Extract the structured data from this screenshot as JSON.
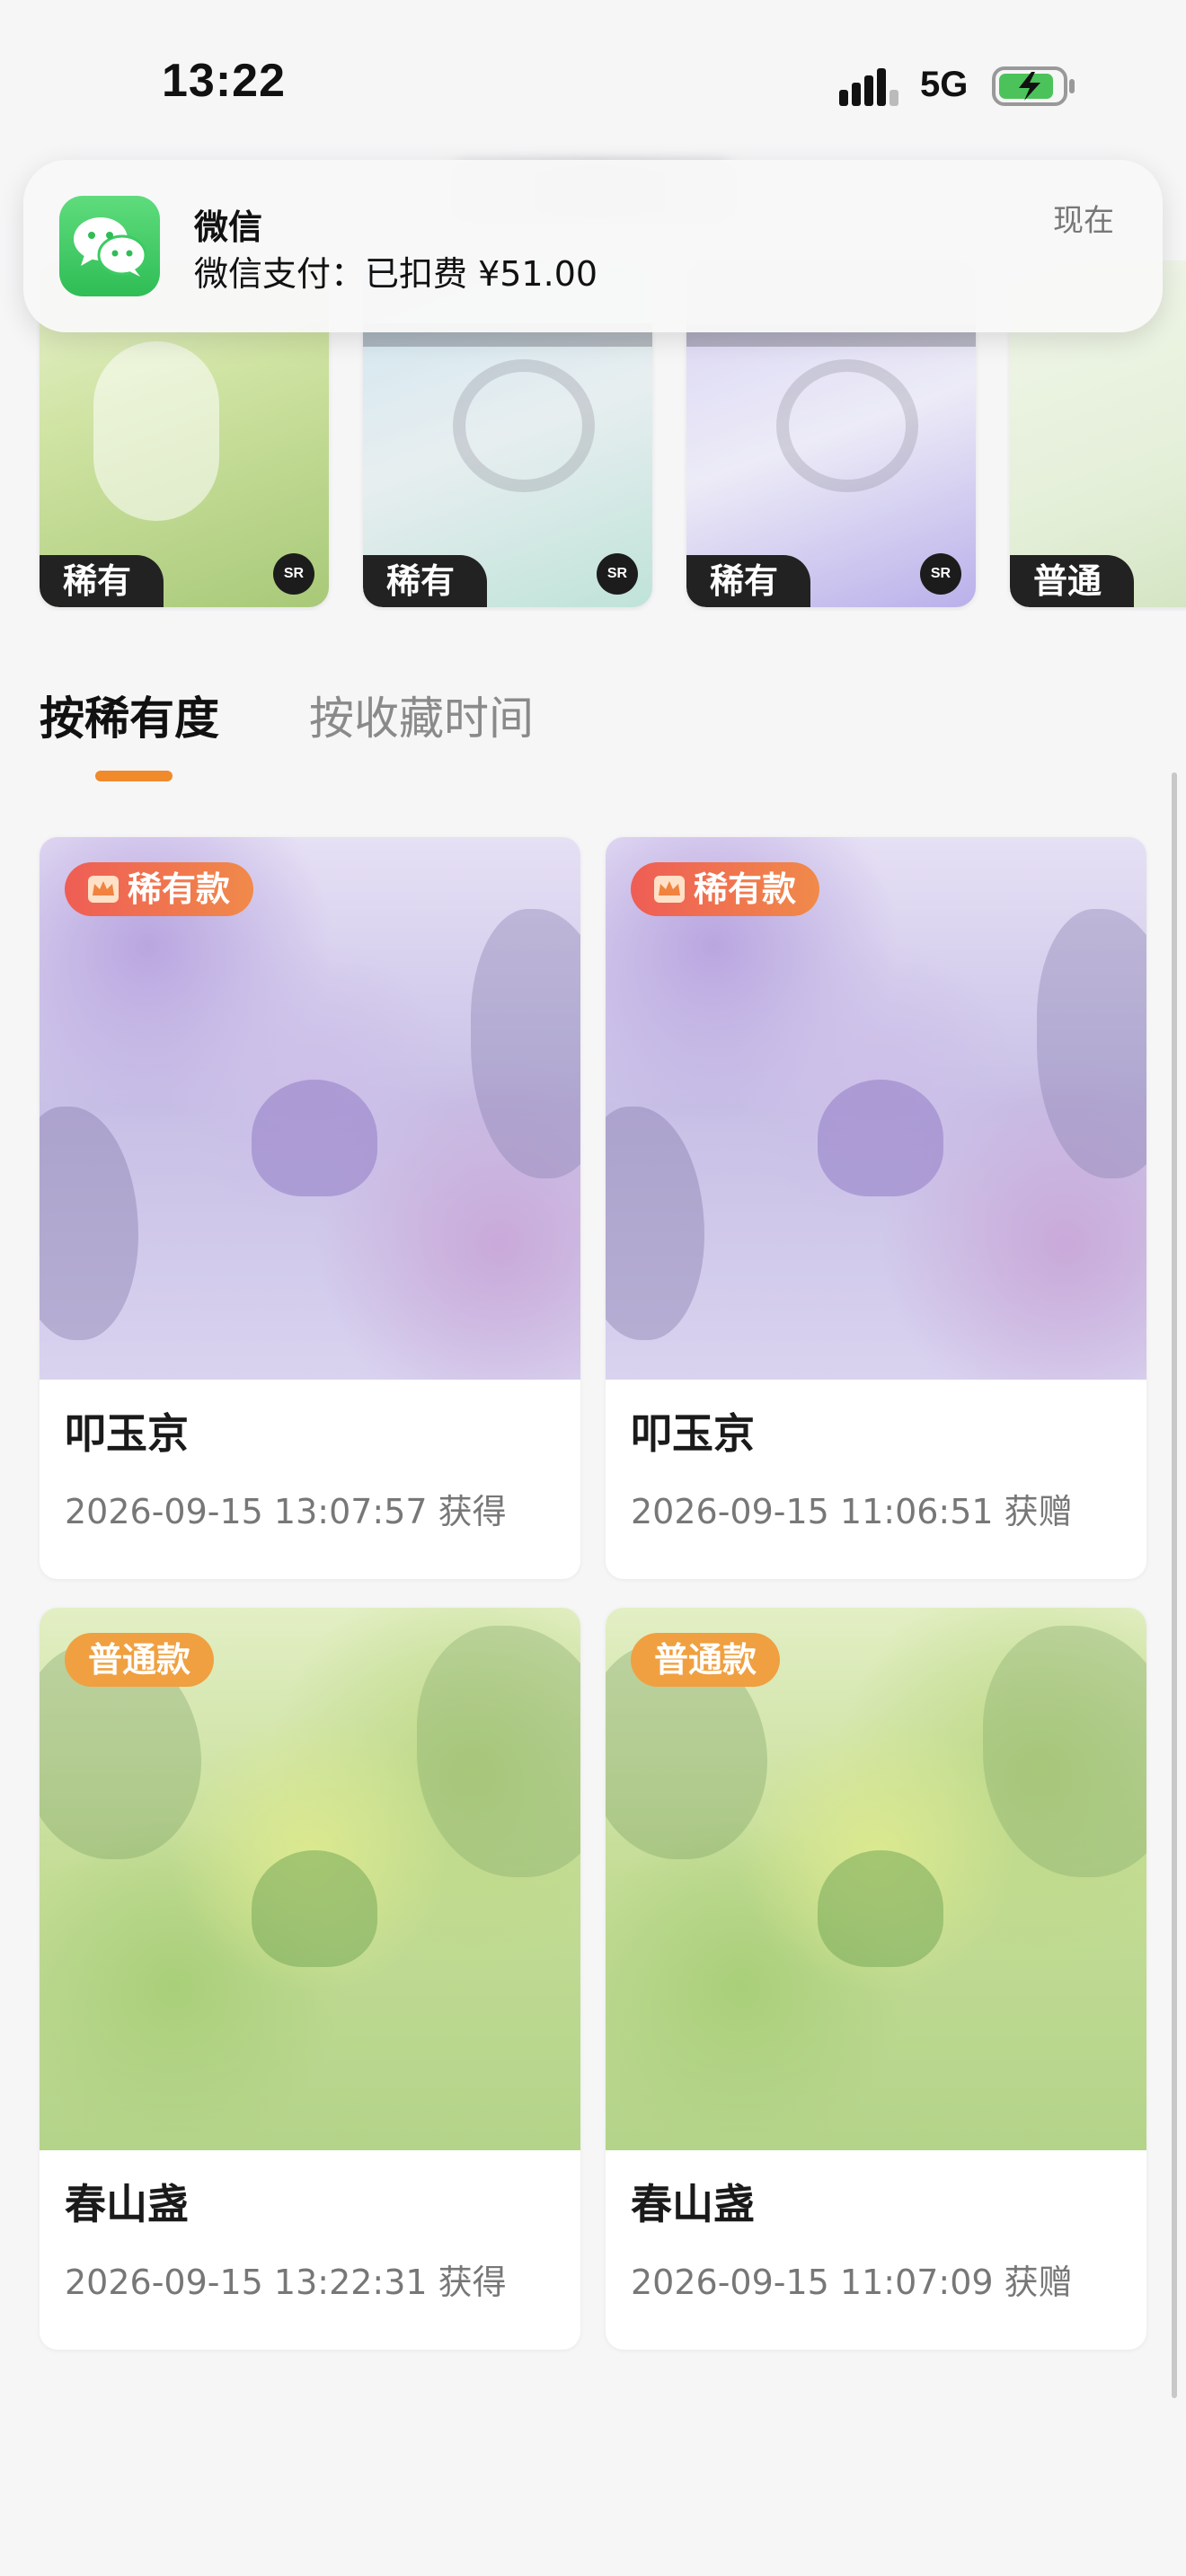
{
  "status_bar": {
    "time": "13:22",
    "network": "5G"
  },
  "notification": {
    "app": "微信",
    "message": "微信支付：已扣费 ¥51.00",
    "time": "现在"
  },
  "top_strip": [
    {
      "rarity": "稀有",
      "badge": "SR"
    },
    {
      "rarity": "稀有",
      "badge": "SR"
    },
    {
      "rarity": "稀有",
      "badge": "SR"
    },
    {
      "rarity": "普通",
      "badge": ""
    }
  ],
  "tabs": [
    {
      "label": "按稀有度",
      "active": true
    },
    {
      "label": "按收藏时间",
      "active": false
    }
  ],
  "cards": [
    {
      "badge": "稀有款",
      "name": "叩玉京",
      "meta": "2026-09-15 13:07:57 获得"
    },
    {
      "badge": "稀有款",
      "name": "叩玉京",
      "meta": "2026-09-15 11:06:51 获赠"
    },
    {
      "badge": "普通款",
      "name": "春山盏",
      "meta": "2026-09-15 13:22:31 获得"
    },
    {
      "badge": "普通款",
      "name": "春山盏",
      "meta": "2026-09-15 11:07:09 获赠"
    }
  ],
  "colors": {
    "accent": "#f08a2a",
    "rare_badge": "#ef5d55",
    "common_badge": "#f0a040",
    "wechat_green": "#2fbd55"
  }
}
